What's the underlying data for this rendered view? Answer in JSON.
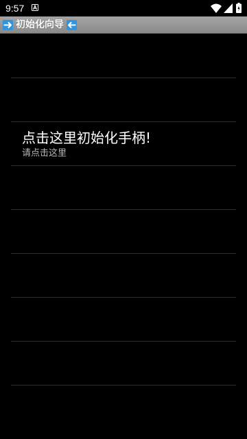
{
  "status_bar": {
    "time": "9:57",
    "icons": [
      "notification-a-icon",
      "wifi-icon",
      "signal-icon",
      "battery-icon"
    ]
  },
  "title_bar": {
    "title": "初始化向导",
    "left_icon": "arrow-right-icon",
    "right_icon": "arrow-left-icon",
    "background": "#999999",
    "icon_color": "#2f95e0"
  },
  "list": {
    "items": [
      {
        "title": "",
        "subtitle": ""
      },
      {
        "title": "",
        "subtitle": ""
      },
      {
        "title": "点击这里初始化手柄!",
        "subtitle": "请点击这里"
      },
      {
        "title": "",
        "subtitle": ""
      },
      {
        "title": "",
        "subtitle": ""
      },
      {
        "title": "",
        "subtitle": ""
      },
      {
        "title": "",
        "subtitle": ""
      },
      {
        "title": "",
        "subtitle": ""
      }
    ]
  }
}
